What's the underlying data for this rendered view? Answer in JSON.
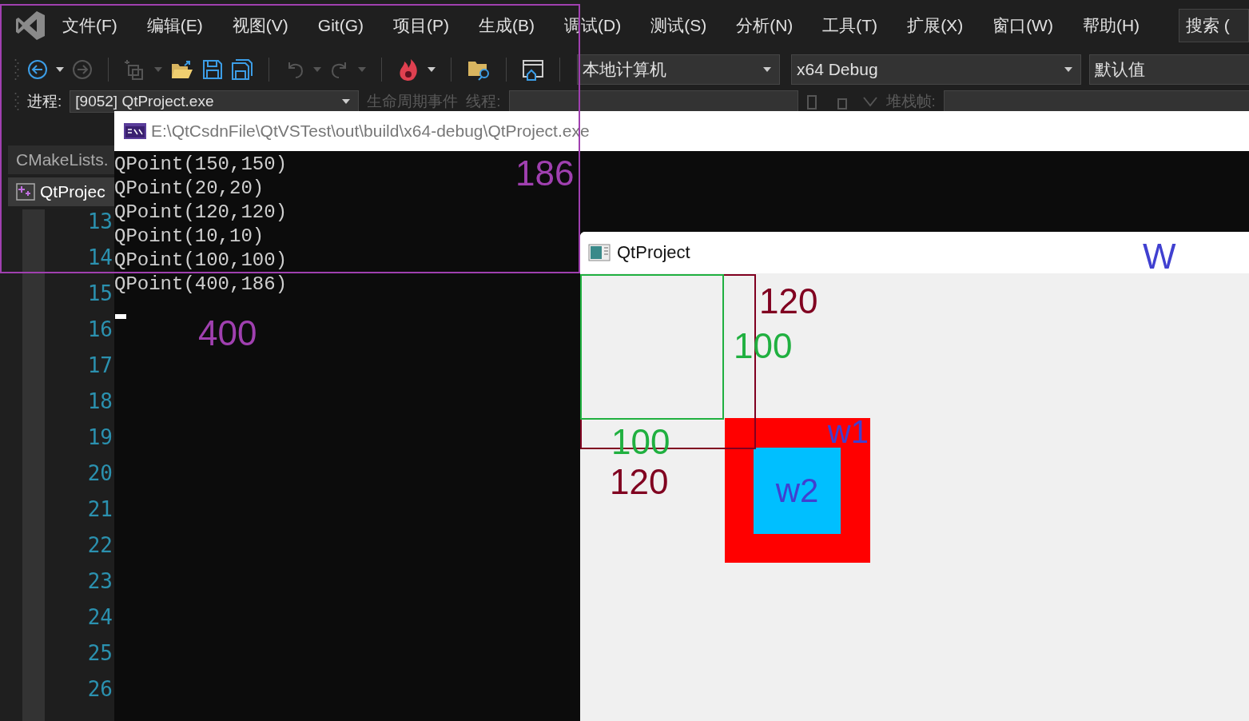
{
  "ide": {
    "menu": [
      "文件(F)",
      "编辑(E)",
      "视图(V)",
      "Git(G)",
      "项目(P)",
      "生成(B)",
      "调试(D)",
      "测试(S)",
      "分析(N)",
      "工具(T)",
      "扩展(X)",
      "窗口(W)",
      "帮助(H)"
    ],
    "search": "搜索 (",
    "toolbar": {
      "target": "本地计算机",
      "configuration": "x64 Debug",
      "startup": "默认值"
    },
    "debug_bar": {
      "label": "进程:",
      "process": "[9052] QtProject.exe",
      "items": [
        {
          "label": "生命周期事件",
          "disabled": true
        },
        {
          "label": "线程:",
          "disabled": true
        },
        {
          "label": "堆栈帧:",
          "disabled": true
        }
      ]
    },
    "tabs": [
      {
        "label": "CMakeLists.",
        "selected": false
      },
      {
        "label": "QtProjec",
        "selected": true
      }
    ],
    "line_numbers": [
      "13",
      "14",
      "15",
      "16",
      "17",
      "18",
      "19",
      "20",
      "21",
      "22",
      "23",
      "24",
      "25",
      "26"
    ]
  },
  "console": {
    "title": "E:\\QtCsdnFile\\QtVSTest\\out\\build\\x64-debug\\QtProject.exe",
    "lines": [
      "QPoint(150,150)",
      "QPoint(20,20)",
      "QPoint(120,120)",
      "QPoint(10,10)",
      "QPoint(100,100)",
      "QPoint(400,186)"
    ]
  },
  "qt_window": {
    "title": "QtProject",
    "widgets": [
      {
        "label": "w1",
        "color": "#ff0000"
      },
      {
        "label": "w2",
        "color": "#00bfff"
      }
    ]
  },
  "annotations": [
    {
      "kind": "frame",
      "color": "#a040b0"
    },
    {
      "kind": "label",
      "text": "186",
      "color": "#a040b0"
    },
    {
      "kind": "label",
      "text": "400",
      "color": "#a040b0"
    },
    {
      "kind": "frame",
      "color": "#800020"
    },
    {
      "kind": "frame",
      "color": "#20b040"
    },
    {
      "kind": "label",
      "text": "120",
      "color": "#800020"
    },
    {
      "kind": "label",
      "text": "100",
      "color": "#20b040"
    },
    {
      "kind": "label",
      "text": "100",
      "color": "#20b040"
    },
    {
      "kind": "label",
      "text": "120",
      "color": "#800020"
    },
    {
      "kind": "label",
      "text": "W",
      "color": "#4040d0"
    }
  ]
}
